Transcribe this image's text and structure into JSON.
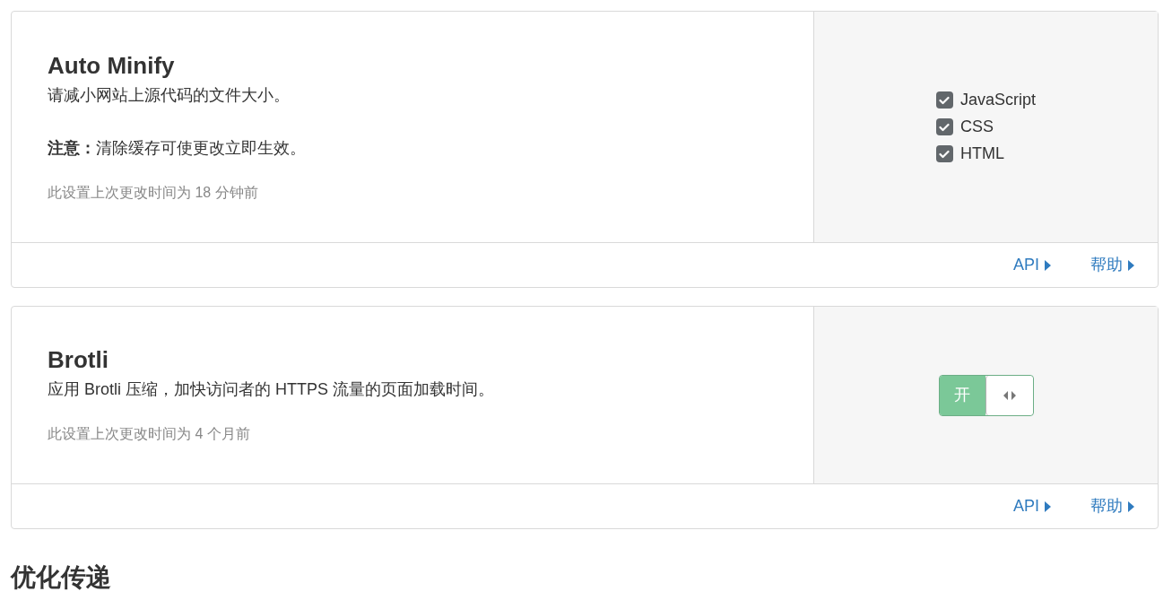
{
  "cards": [
    {
      "title": "Auto Minify",
      "description": "请减小网站上源代码的文件大小。",
      "note": "**注意：**清除缓存可使更改立即生效。",
      "last_changed": "此设置上次更改时间为 18 分钟前",
      "control": {
        "kind": "checkboxes",
        "options": [
          {
            "label": "JavaScript",
            "checked": true
          },
          {
            "label": "CSS",
            "checked": true
          },
          {
            "label": "HTML",
            "checked": true
          }
        ]
      },
      "links": [
        "API",
        "帮助"
      ]
    },
    {
      "title": "Brotli",
      "description": "应用 Brotli 压缩，加快访问者的 HTTPS 流量的页面加载时间。",
      "last_changed": "此设置上次更改时间为 4 个月前",
      "control": {
        "kind": "toggle",
        "on": true,
        "label": "开"
      },
      "links": [
        "API",
        "帮助"
      ]
    }
  ],
  "section_heading": "优化传递"
}
